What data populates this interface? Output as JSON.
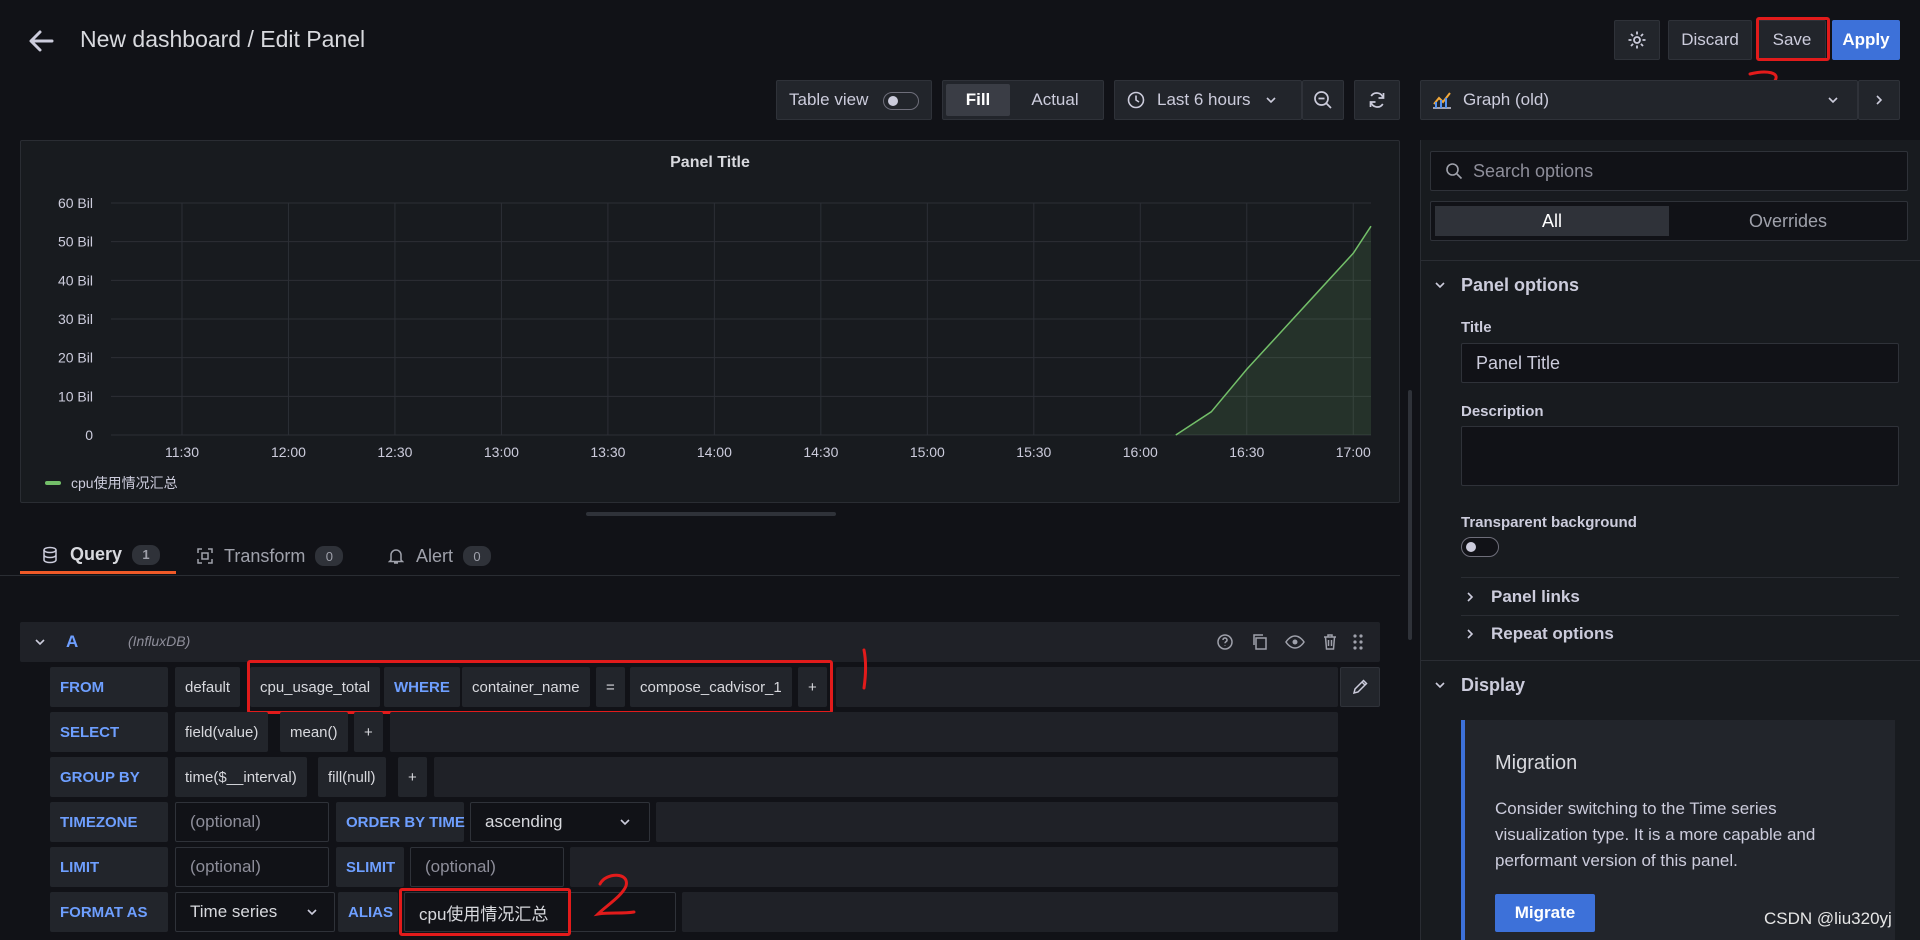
{
  "header": {
    "title": "New dashboard / Edit Panel",
    "discard_label": "Discard",
    "save_label": "Save",
    "apply_label": "Apply"
  },
  "toolbar": {
    "table_view_label": "Table view",
    "fill_label": "Fill",
    "actual_label": "Actual",
    "time_range": "Last 6 hours",
    "viz_name": "Graph (old)"
  },
  "panel": {
    "title": "Panel Title",
    "legend": "cpu使用情况汇总"
  },
  "chart_data": {
    "type": "area",
    "title": "Panel Title",
    "x": [
      "16:10",
      "16:20",
      "16:30",
      "16:40",
      "16:50",
      "17:00",
      "17:05"
    ],
    "series": [
      {
        "name": "cpu使用情况汇总",
        "values": [
          0,
          6,
          17,
          27,
          37,
          47,
          54
        ]
      }
    ],
    "x_ticks": [
      "11:30",
      "12:00",
      "12:30",
      "13:00",
      "13:30",
      "14:00",
      "14:30",
      "15:00",
      "15:30",
      "16:00",
      "16:30",
      "17:00"
    ],
    "y_ticks": [
      "0",
      "10 Bil",
      "20 Bil",
      "30 Bil",
      "40 Bil",
      "50 Bil",
      "60 Bil"
    ],
    "ylim": [
      0,
      60
    ],
    "y_unit": "Bil",
    "x_range": [
      "11:10",
      "17:05"
    ],
    "grid": true,
    "legend_position": "bottom-left",
    "color": "#73bf69"
  },
  "tabs": {
    "query_label": "Query",
    "query_count": "1",
    "transform_label": "Transform",
    "transform_count": "0",
    "alert_label": "Alert",
    "alert_count": "0"
  },
  "query": {
    "ref_id": "A",
    "datasource": "(InfluxDB)",
    "from_label": "FROM",
    "from_policy": "default",
    "measurement": "cpu_usage_total",
    "where_label": "WHERE",
    "where_key": "container_name",
    "where_op": "=",
    "where_value": "compose_cadvisor_1",
    "plus": "+",
    "select_label": "SELECT",
    "select_field": "field(value)",
    "select_agg": "mean()",
    "groupby_label": "GROUP BY",
    "groupby_time": "time($__interval)",
    "groupby_fill": "fill(null)",
    "timezone_label": "TIMEZONE",
    "optional_placeholder": "(optional)",
    "orderby_label": "ORDER BY TIME",
    "orderby_value": "ascending",
    "limit_label": "LIMIT",
    "slimit_label": "SLIMIT",
    "format_label": "FORMAT AS",
    "format_value": "Time series",
    "alias_label": "ALIAS",
    "alias_value": "cpu使用情况汇总"
  },
  "options": {
    "search_placeholder": "Search options",
    "all_label": "All",
    "overrides_label": "Overrides",
    "panel_options_label": "Panel options",
    "title_label": "Title",
    "title_value": "Panel Title",
    "description_label": "Description",
    "transparent_label": "Transparent background",
    "panel_links_label": "Panel links",
    "repeat_options_label": "Repeat options",
    "display_label": "Display",
    "migration_title": "Migration",
    "migration_text": "Consider switching to the Time series visualization type. It is a more capable and performant version of this panel.",
    "migrate_label": "Migrate"
  },
  "annotations": {
    "one": "1",
    "two": "2",
    "three": "3"
  },
  "watermark": "CSDN @liu320yj"
}
